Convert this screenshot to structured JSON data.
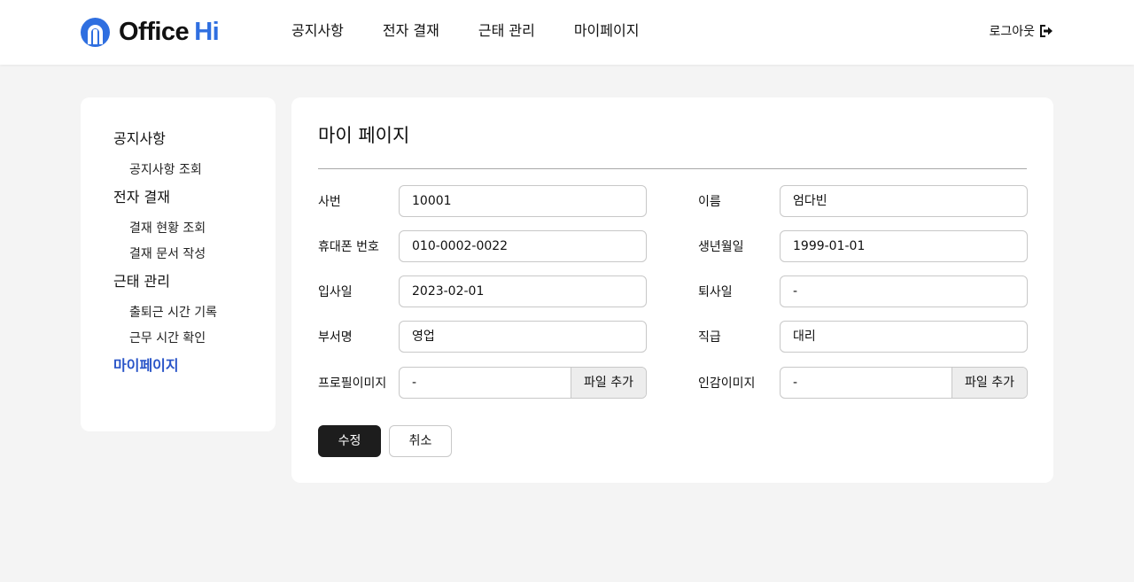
{
  "header": {
    "logo": {
      "part1": "Office",
      "part2": "Hi"
    },
    "nav": [
      "공지사항",
      "전자 결재",
      "근태 관리",
      "마이페이지"
    ],
    "logout_label": "로그아웃"
  },
  "sidebar": {
    "groups": [
      {
        "label": "공지사항",
        "items": [
          "공지사항 조회"
        ]
      },
      {
        "label": "전자 결재",
        "items": [
          "결재 현황 조회",
          "결재 문서 작성"
        ]
      },
      {
        "label": "근태 관리",
        "items": [
          "출퇴근 시간 기록",
          "근무 시간 확인"
        ]
      },
      {
        "label": "마이페이지",
        "items": []
      }
    ]
  },
  "main": {
    "title": "마이 페이지",
    "fields": {
      "emp_no": {
        "label": "사번",
        "value": "10001"
      },
      "name": {
        "label": "이름",
        "value": "엄다빈"
      },
      "phone": {
        "label": "휴대폰 번호",
        "value": "010-0002-0022"
      },
      "birth": {
        "label": "생년월일",
        "value": "1999-01-01"
      },
      "join_date": {
        "label": "입사일",
        "value": "2023-02-01"
      },
      "leave_date": {
        "label": "퇴사일",
        "value": "-"
      },
      "dept": {
        "label": "부서명",
        "value": "영업"
      },
      "rank": {
        "label": "직급",
        "value": "대리"
      },
      "profile_image": {
        "label": "프로필이미지",
        "value": "-",
        "button": "파일 추가"
      },
      "seal_image": {
        "label": "인감이미지",
        "value": "-",
        "button": "파일 추가"
      }
    },
    "buttons": {
      "edit": "수정",
      "cancel": "취소"
    }
  },
  "colors": {
    "accent": "#2f6fe0",
    "active_nav": "#2a55c8",
    "primary_button": "#1d1d1d",
    "background": "#f4f4f4"
  }
}
